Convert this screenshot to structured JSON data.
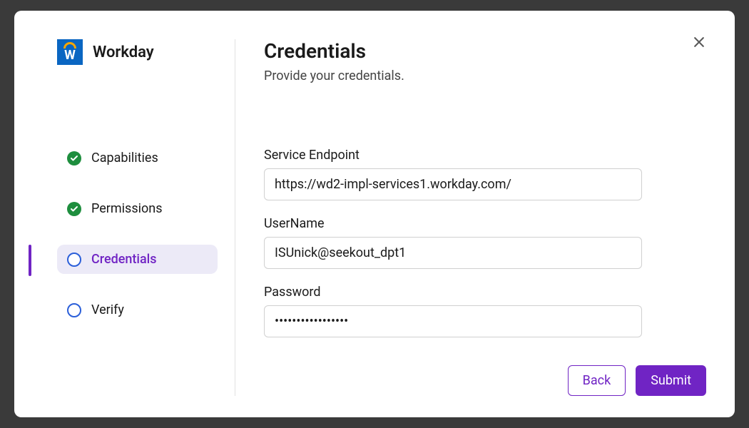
{
  "brand": {
    "name": "Workday"
  },
  "steps": {
    "items": [
      {
        "label": "Capabilities",
        "state": "done"
      },
      {
        "label": "Permissions",
        "state": "done"
      },
      {
        "label": "Credentials",
        "state": "current"
      },
      {
        "label": "Verify",
        "state": "pending"
      }
    ]
  },
  "page": {
    "title": "Credentials",
    "subtitle": "Provide your credentials."
  },
  "form": {
    "service_endpoint": {
      "label": "Service Endpoint",
      "value": "https://wd2-impl-services1.workday.com/"
    },
    "username": {
      "label": "UserName",
      "value": "ISUnick@seekout_dpt1"
    },
    "password": {
      "label": "Password",
      "value": "•••••••••••••••••"
    }
  },
  "buttons": {
    "back": "Back",
    "submit": "Submit"
  }
}
